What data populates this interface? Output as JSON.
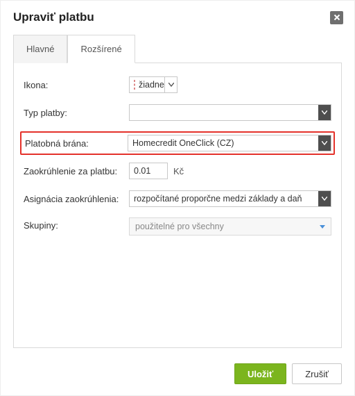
{
  "dialog": {
    "title": "Upraviť platbu",
    "tabs": {
      "main": "Hlavné",
      "extended": "Rozšírené"
    },
    "fields": {
      "icon_label": "Ikona:",
      "icon_value": "žiadne",
      "payment_type_label": "Typ platby:",
      "payment_type_value": "",
      "gateway_label": "Platobná brána:",
      "gateway_value": "Homecredit OneClick (CZ)",
      "rounding_label": "Zaokrúhlenie za platbu:",
      "rounding_value": "0.01",
      "rounding_unit": "Kč",
      "assign_label": "Asignácia zaokrúhlenia:",
      "assign_value": "rozpočítané proporčne medzi základy a daň",
      "groups_label": "Skupiny:",
      "groups_placeholder": "použitelné pro všechny"
    },
    "buttons": {
      "save": "Uložiť",
      "cancel": "Zrušiť"
    }
  }
}
